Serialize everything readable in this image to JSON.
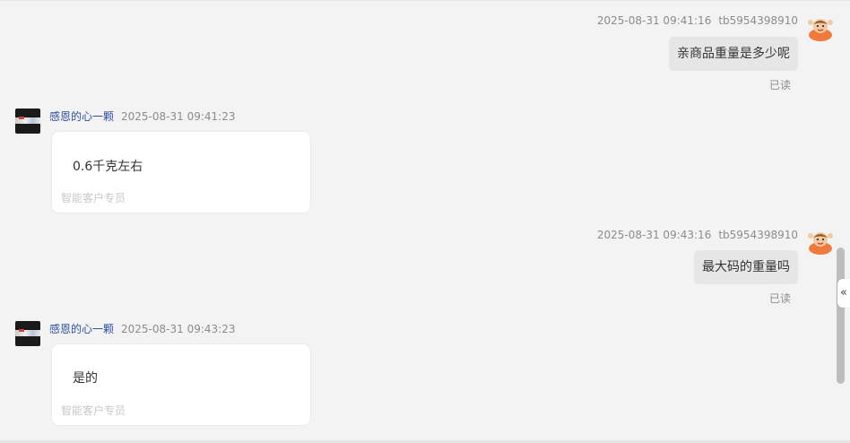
{
  "messages": {
    "m1": {
      "time": "2025-08-31 09:41:16",
      "user": "tb5954398910",
      "text": "亲商品重量是多少呢",
      "status": "已读"
    },
    "m2": {
      "name": "感恩的心一颗",
      "time": "2025-08-31 09:41:23",
      "text": "0.6千克左右",
      "tag": "智能客户专员"
    },
    "m3": {
      "time": "2025-08-31 09:43:16",
      "user": "tb5954398910",
      "text": "最大码的重量吗",
      "status": "已读"
    },
    "m4": {
      "name": "感恩的心一颗",
      "time": "2025-08-31 09:43:23",
      "text": "是的",
      "tag": "智能客户专员"
    }
  },
  "side_toggle_icon": "«",
  "colors": {
    "background": "#f3f3f3",
    "sent_bubble": "#e6e6e6",
    "agent_name": "#2f4fa2",
    "meta_text": "#8c8c8c"
  }
}
